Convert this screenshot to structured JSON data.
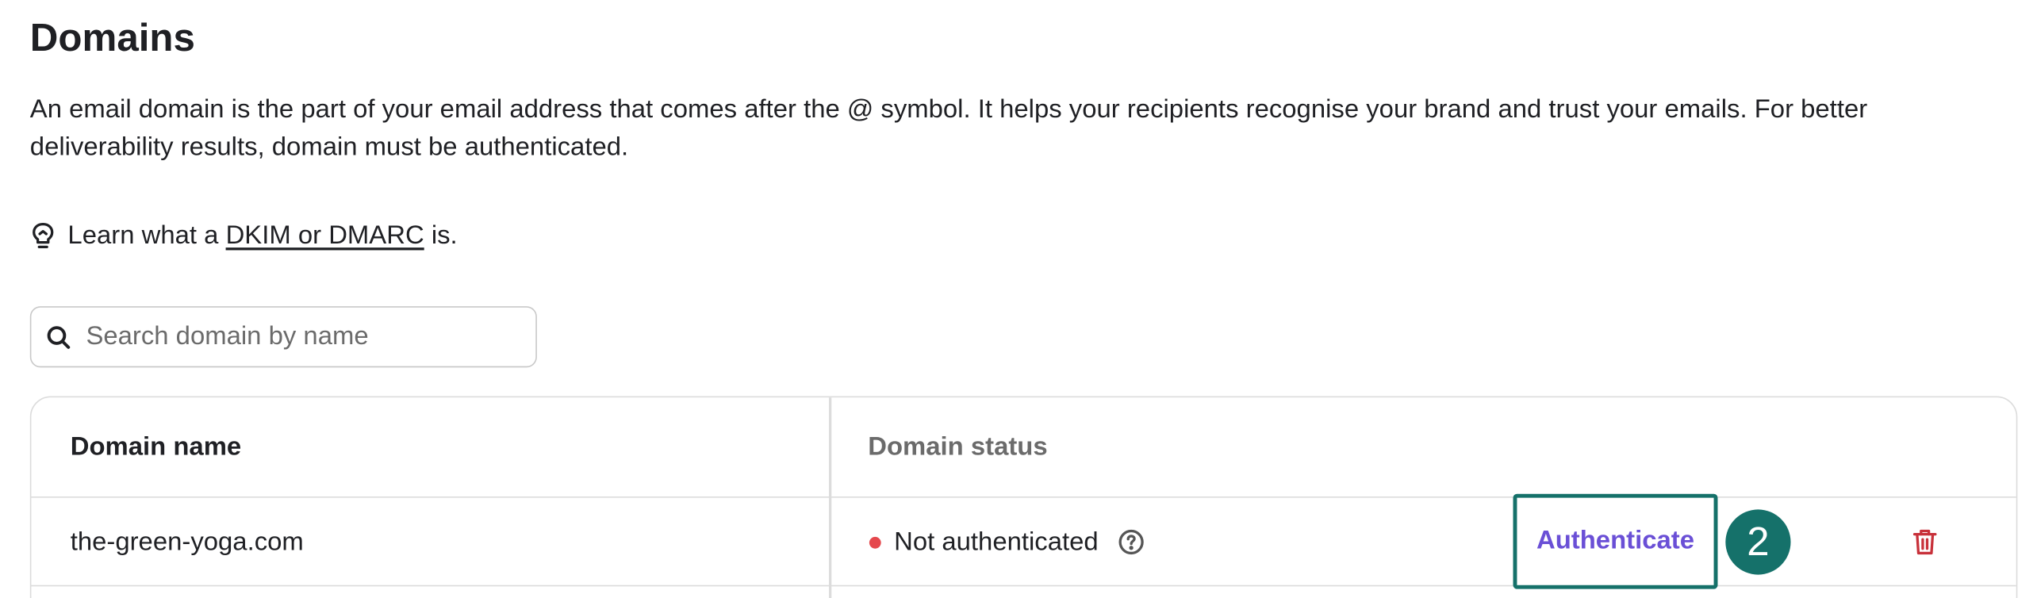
{
  "page": {
    "title": "Domains",
    "intro": "An email domain is the part of your email address that comes after the @ symbol. It helps your recipients recognise your brand and trust your emails. For better deliverability results, domain must be authenticated."
  },
  "learn": {
    "prefix": "Learn what a ",
    "link_text": "DKIM or DMARC",
    "suffix": " is.",
    "icon": "lightbulb-icon"
  },
  "search": {
    "placeholder": "Search domain by name",
    "value": "",
    "icon": "search-icon"
  },
  "table": {
    "columns": [
      "Domain name",
      "Domain status"
    ],
    "rows": [
      {
        "domain": "the-green-yoga.com",
        "status": "Not authenticated",
        "status_color": "#e5484d",
        "action_label": "Authenticate",
        "step_badge": "2"
      }
    ]
  },
  "colors": {
    "accent_purple": "#6a4fd6",
    "highlight_teal": "#15716a",
    "danger_red": "#c8313a",
    "text": "#1f2024",
    "muted": "#6b6b6b",
    "border": "#dcdcdc"
  }
}
